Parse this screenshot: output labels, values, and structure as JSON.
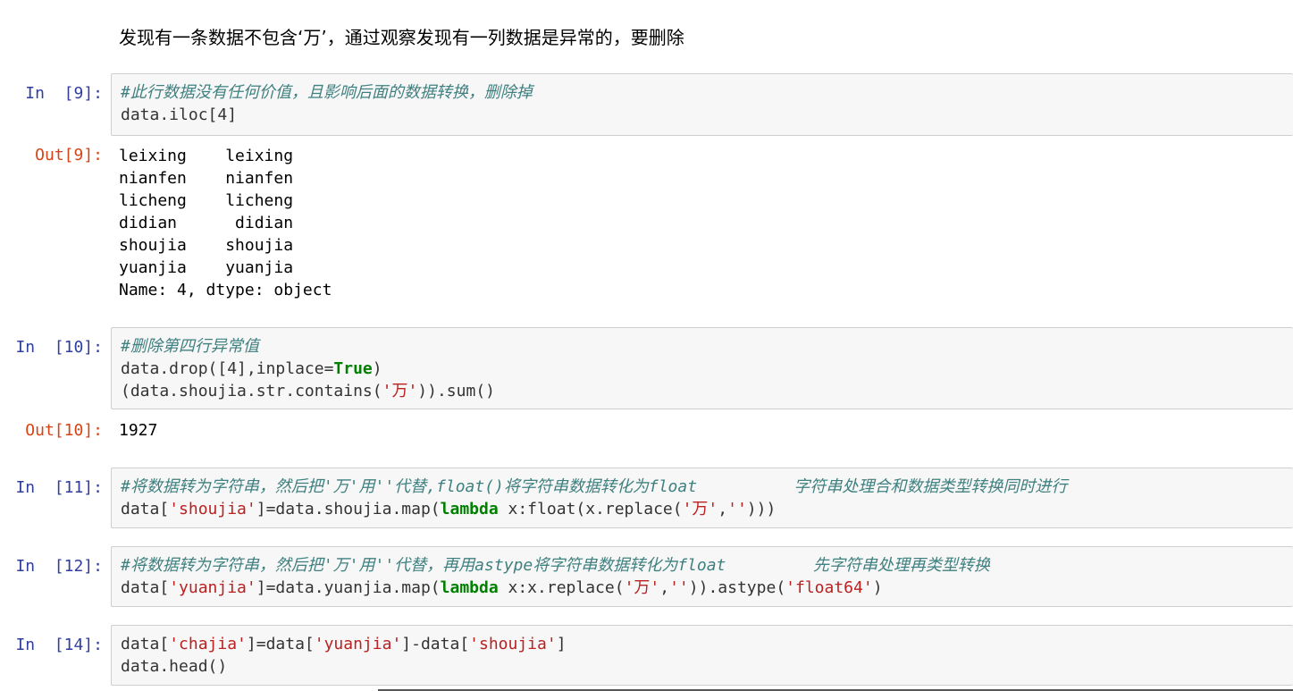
{
  "markdown": "发现有一条数据不包含‘万’，通过观察发现有一列数据是异常的，要删除",
  "cells": [
    {
      "in_prompt": "In  [9]:",
      "lines": [
        [
          {
            "t": "#此行数据没有任何价值，且影响后面的数据转换，删除掉",
            "c": "cm"
          }
        ],
        [
          {
            "t": "data.iloc[4]",
            "c": ""
          }
        ]
      ],
      "out_prompt": "Out[9]:",
      "output": "leixing    leixing\nnianfen    nianfen\nlicheng    licheng\ndidian      didian\nshoujia    shoujia\nyuanjia    yuanjia\nName: 4, dtype: object"
    },
    {
      "in_prompt": "In  [10]:",
      "lines": [
        [
          {
            "t": "#删除第四行异常值",
            "c": "cm"
          }
        ],
        [
          {
            "t": "data.drop([4],inplace=",
            "c": ""
          },
          {
            "t": "True",
            "c": "kw"
          },
          {
            "t": ")",
            "c": ""
          }
        ],
        [
          {
            "t": "(data.shoujia.str.contains(",
            "c": ""
          },
          {
            "t": "'万'",
            "c": "st"
          },
          {
            "t": ")).sum()",
            "c": ""
          }
        ]
      ],
      "out_prompt": "Out[10]:",
      "output": "1927"
    },
    {
      "in_prompt": "In  [11]:",
      "lines": [
        [
          {
            "t": "#将数据转为字符串，然后把'万'用''代替,float()将字符串数据转化为float          字符串处理合和数据类型转换同时进行",
            "c": "cm"
          }
        ],
        [
          {
            "t": "data[",
            "c": ""
          },
          {
            "t": "'shoujia'",
            "c": "st"
          },
          {
            "t": "]=data.shoujia.map(",
            "c": ""
          },
          {
            "t": "lambda",
            "c": "kw"
          },
          {
            "t": " x:float(x.replace(",
            "c": ""
          },
          {
            "t": "'万'",
            "c": "st"
          },
          {
            "t": ",",
            "c": ""
          },
          {
            "t": "''",
            "c": "st"
          },
          {
            "t": ")))",
            "c": ""
          }
        ]
      ]
    },
    {
      "in_prompt": "In  [12]:",
      "lines": [
        [
          {
            "t": "#将数据转为字符串，然后把'万'用''代替，再用astype将字符串数据转化为float         先字符串处理再类型转换",
            "c": "cm"
          }
        ],
        [
          {
            "t": "data[",
            "c": ""
          },
          {
            "t": "'yuanjia'",
            "c": "st"
          },
          {
            "t": "]=data.yuanjia.map(",
            "c": ""
          },
          {
            "t": "lambda",
            "c": "kw"
          },
          {
            "t": " x:x.replace(",
            "c": ""
          },
          {
            "t": "'万'",
            "c": "st"
          },
          {
            "t": ",",
            "c": ""
          },
          {
            "t": "''",
            "c": "st"
          },
          {
            "t": ")).astype(",
            "c": ""
          },
          {
            "t": "'float64'",
            "c": "st"
          },
          {
            "t": ")",
            "c": ""
          }
        ]
      ]
    },
    {
      "in_prompt": "In  [14]:",
      "lines": [
        [
          {
            "t": "data[",
            "c": ""
          },
          {
            "t": "'chajia'",
            "c": "st"
          },
          {
            "t": "]=data[",
            "c": ""
          },
          {
            "t": "'yuanjia'",
            "c": "st"
          },
          {
            "t": "]-data[",
            "c": ""
          },
          {
            "t": "'shoujia'",
            "c": "st"
          },
          {
            "t": "]",
            "c": ""
          }
        ],
        [
          {
            "t": "data.head()",
            "c": ""
          }
        ]
      ]
    }
  ]
}
